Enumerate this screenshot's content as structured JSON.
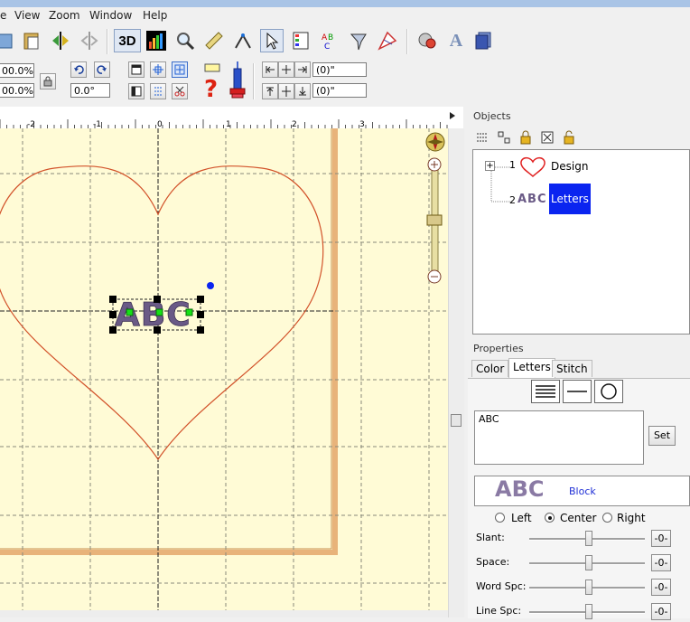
{
  "menu": {
    "items": [
      "e",
      "View",
      "Zoom",
      "Window",
      "Help"
    ]
  },
  "toolbar": {
    "view_3d_label": "3D",
    "zoom_x": "00.0%",
    "zoom_y": "00.0%",
    "rotation": "0.0°",
    "offset_x": "(0)\"",
    "offset_y": "(0)\""
  },
  "ruler": {
    "labels": [
      "-2",
      "-1",
      "0",
      "1",
      "2",
      "3"
    ]
  },
  "design": {
    "text": "ABC"
  },
  "objects": {
    "title": "Objects",
    "items": [
      {
        "index": "1",
        "name": "Design"
      },
      {
        "index": "2",
        "thumb": "ABC",
        "name": "Letters"
      }
    ]
  },
  "properties": {
    "title": "Properties",
    "tabs": [
      "Color",
      "Letters",
      "Stitch"
    ],
    "active_tab": "Letters",
    "text_value": "ABC",
    "set_label": "Set",
    "font_preview": "ABC",
    "font_name": "Block",
    "align": {
      "left": "Left",
      "center": "Center",
      "right": "Right",
      "selected": "Center"
    },
    "sliders": [
      {
        "label": "Slant:",
        "value": "-0-"
      },
      {
        "label": "Space:",
        "value": "-0-"
      },
      {
        "label": "Word Spc:",
        "value": "-0-"
      },
      {
        "label": "Line Spc:",
        "value": "-0-"
      }
    ]
  },
  "colors": {
    "selection": "#0a24f0",
    "canvas": "#fffbd6",
    "heart": "#d2522a",
    "letters": "#6a5a86"
  }
}
